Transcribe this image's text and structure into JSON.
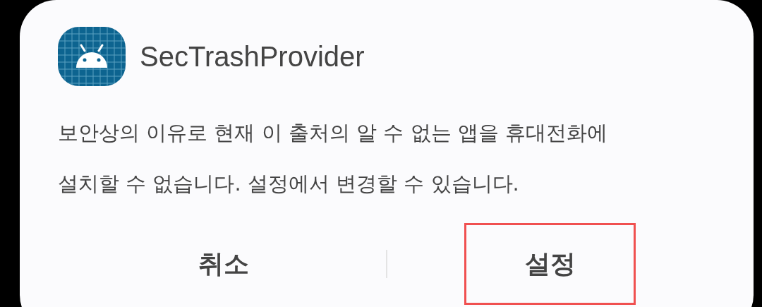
{
  "dialog": {
    "app_name": "SecTrashProvider",
    "message_lines": [
      "보안상의 이유로 현재 이 출처의 알 수 없는 앱을 휴대전화에",
      "설치할 수 없습니다. 설정에서 변경할 수 있습니다."
    ],
    "buttons": [
      {
        "label": "취소",
        "highlighted": false
      },
      {
        "label": "설정",
        "highlighted": true
      }
    ]
  }
}
